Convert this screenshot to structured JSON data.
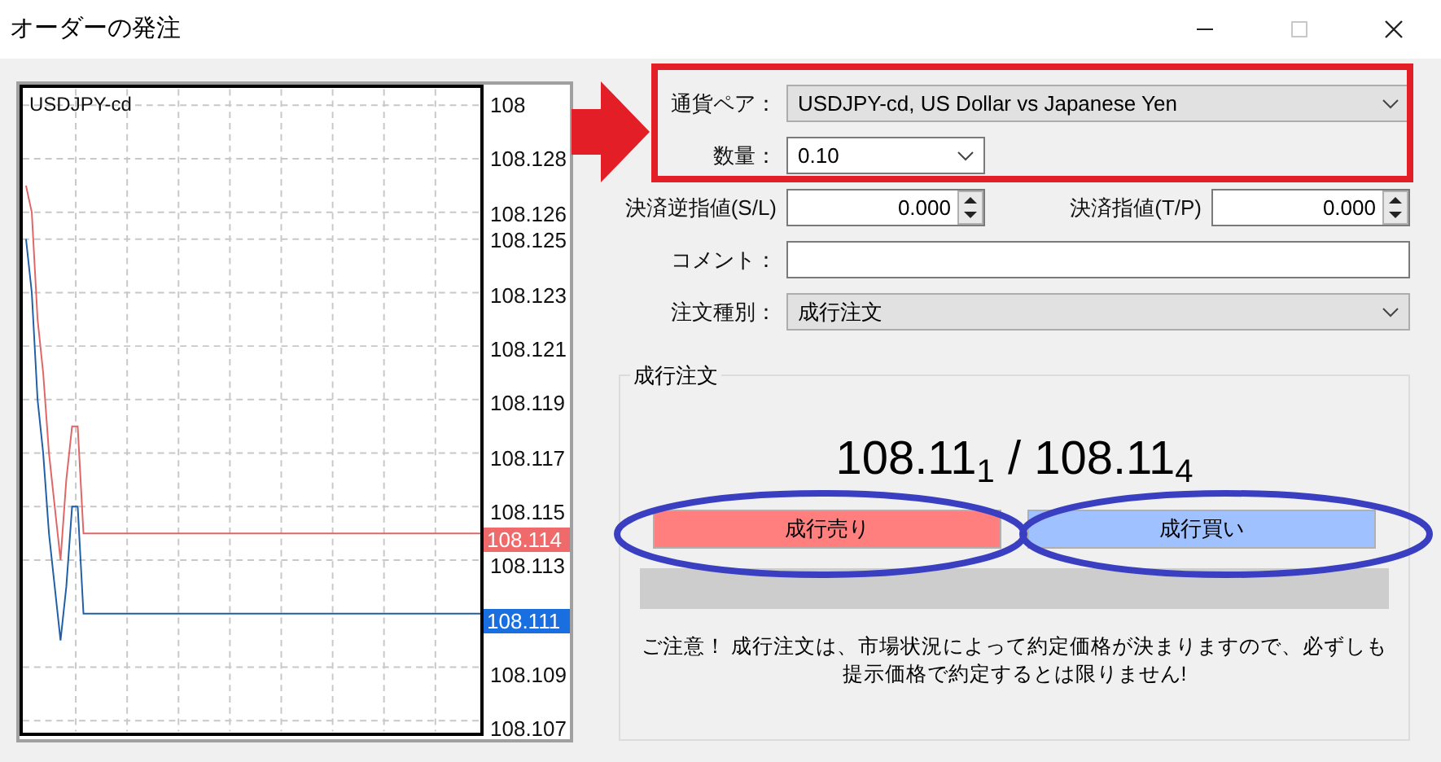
{
  "window": {
    "title": "オーダーの発注",
    "controls": [
      {
        "kind": "minimize",
        "disabled": false
      },
      {
        "kind": "maximize",
        "disabled": true
      },
      {
        "kind": "close",
        "disabled": false
      }
    ]
  },
  "chart": {
    "symbol": "USDJPY-cd",
    "ask_marker": "108.114",
    "bid_marker": "108.111",
    "chart_data": {
      "type": "line",
      "grid": true,
      "categories": [
        null,
        null,
        null,
        null,
        null,
        null,
        null,
        null,
        null,
        null,
        null,
        null,
        null,
        null,
        null,
        null,
        null,
        null,
        null,
        null,
        null,
        null,
        null,
        null,
        null,
        null,
        null,
        null,
        null,
        null,
        null,
        null,
        null,
        null,
        null,
        null,
        null,
        null,
        null,
        null,
        null,
        null,
        null,
        null,
        null,
        null,
        null,
        null,
        null,
        null,
        null,
        null,
        null,
        null,
        null,
        null,
        null,
        null,
        null,
        null,
        null,
        null,
        null,
        null,
        null,
        null,
        null,
        null,
        null,
        null,
        null,
        null,
        null,
        null,
        null,
        null,
        null,
        null,
        null,
        null
      ],
      "ylim": [
        108.1066,
        108.1306
      ],
      "yticks": [
        {
          "value": 108.13,
          "label": "108"
        },
        108.128,
        108.126,
        108.125,
        108.123,
        108.121,
        108.119,
        108.117,
        108.115,
        108.113,
        108.109,
        108.107
      ],
      "series": [
        {
          "color": "#e06666",
          "values": [
            108.127,
            108.126,
            108.122,
            108.12,
            108.117,
            108.115,
            108.113,
            108.116,
            108.118,
            108.118,
            108.114,
            108.114,
            108.114,
            108.114,
            108.114,
            108.114,
            108.114,
            108.114,
            108.114,
            108.114,
            108.114,
            108.114,
            108.114,
            108.114,
            108.114,
            108.114,
            108.114,
            108.114,
            108.114,
            108.114,
            108.114,
            108.114,
            108.114,
            108.114,
            108.114,
            108.114,
            108.114,
            108.114,
            108.114,
            108.114,
            108.114,
            108.114,
            108.114,
            108.114,
            108.114,
            108.114,
            108.114,
            108.114,
            108.114,
            108.114,
            108.114,
            108.114,
            108.114,
            108.114,
            108.114,
            108.114,
            108.114,
            108.114,
            108.114,
            108.114,
            108.114,
            108.114,
            108.114,
            108.114,
            108.114,
            108.114,
            108.114,
            108.114,
            108.114,
            108.114,
            108.114,
            108.114,
            108.114,
            108.114,
            108.114,
            108.114,
            108.114,
            108.114,
            108.114,
            108.114
          ]
        },
        {
          "color": "#1f5fa8",
          "values": [
            108.125,
            108.123,
            108.119,
            108.117,
            108.114,
            108.112,
            108.11,
            108.112,
            108.115,
            108.115,
            108.111,
            108.111,
            108.111,
            108.111,
            108.111,
            108.111,
            108.111,
            108.111,
            108.111,
            108.111,
            108.111,
            108.111,
            108.111,
            108.111,
            108.111,
            108.111,
            108.111,
            108.111,
            108.111,
            108.111,
            108.111,
            108.111,
            108.111,
            108.111,
            108.111,
            108.111,
            108.111,
            108.111,
            108.111,
            108.111,
            108.111,
            108.111,
            108.111,
            108.111,
            108.111,
            108.111,
            108.111,
            108.111,
            108.111,
            108.111,
            108.111,
            108.111,
            108.111,
            108.111,
            108.111,
            108.111,
            108.111,
            108.111,
            108.111,
            108.111,
            108.111,
            108.111,
            108.111,
            108.111,
            108.111,
            108.111,
            108.111,
            108.111,
            108.111,
            108.111,
            108.111,
            108.111,
            108.111,
            108.111,
            108.111,
            108.111,
            108.111,
            108.111,
            108.111,
            108.111
          ]
        }
      ]
    }
  },
  "form": {
    "symbol": {
      "label": "通貨ペア：",
      "value": "USDJPY-cd, US Dollar vs Japanese Yen"
    },
    "volume": {
      "label": "数量：",
      "value": "0.10"
    },
    "stop_loss": {
      "label": "決済逆指値(S/L)",
      "value": "0.000"
    },
    "take_profit": {
      "label": "決済指値(T/P)",
      "value": "0.000"
    },
    "comment": {
      "label": "コメント："
    },
    "order_type": {
      "label": "注文種別：",
      "value": "成行注文"
    }
  },
  "market_order": {
    "legend": "成行注文",
    "price": "108.11$_{1}$ / 108.11$_{4}$",
    "sell_button": "成行売り",
    "buy_button": "成行買い",
    "notice_lines": [
      "ご注意！ 成行注文は、市場状況によって約定価格が決まりますので、必ずしも",
      "提示価格で約定するとは限りません!"
    ]
  },
  "annotations": [
    {
      "kind": "box",
      "color": "#e41e26"
    },
    {
      "kind": "arrow",
      "color": "#e41e26"
    },
    {
      "kind": "ellipse",
      "color": "#3a3fc2"
    },
    {
      "kind": "ellipse",
      "color": "#3a3fc2"
    }
  ]
}
